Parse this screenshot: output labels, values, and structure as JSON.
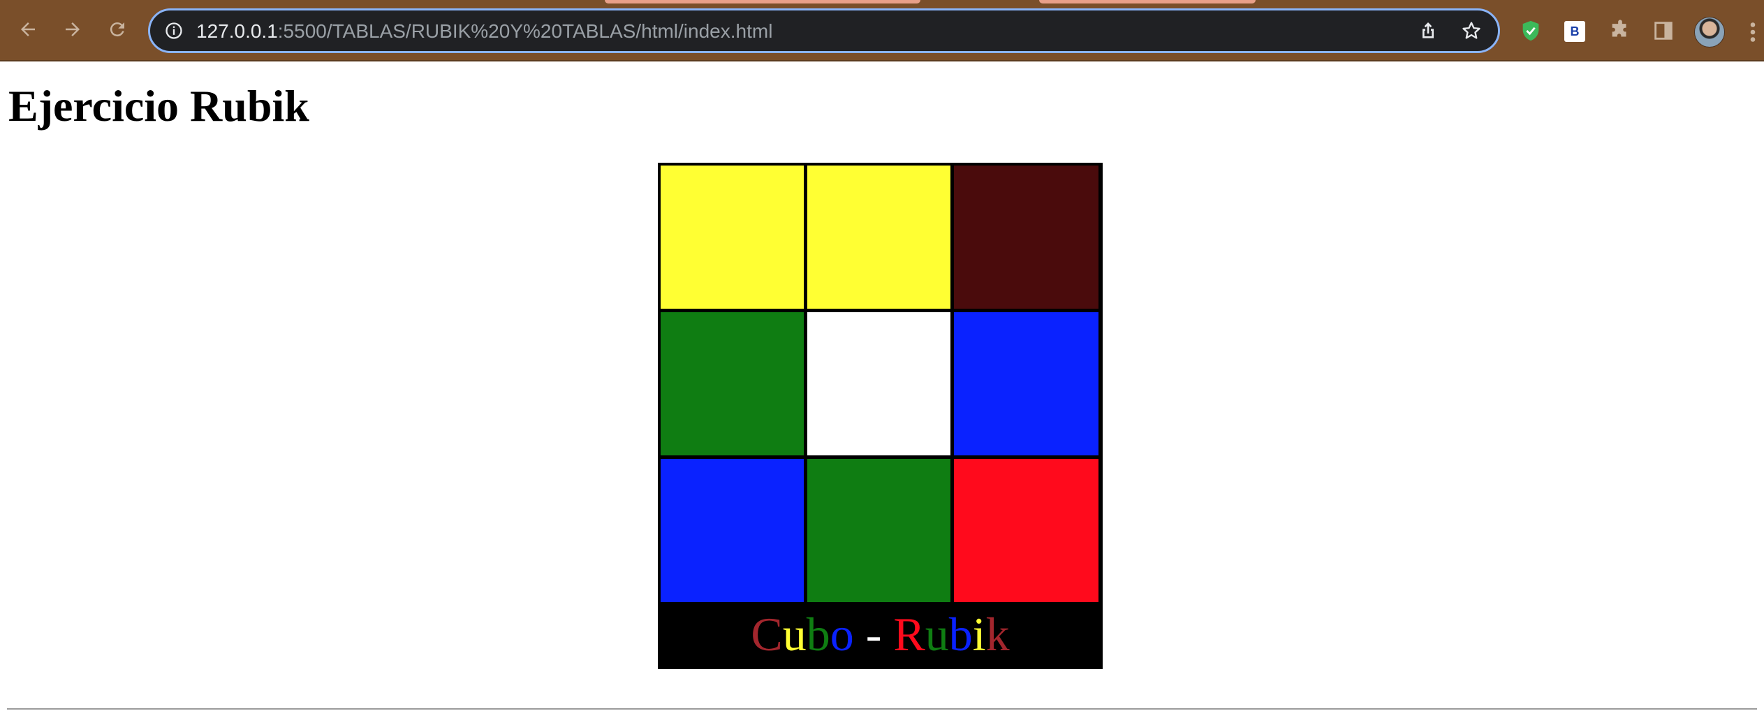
{
  "browser": {
    "url_host": "127.0.0.1",
    "url_path": ":5500/TABLAS/RUBIK%20Y%20TABLAS/html/index.html",
    "extension_b_label": "B",
    "nav_icons": [
      "back-arrow-icon",
      "forward-arrow-icon",
      "reload-icon"
    ],
    "toolbar_icons": [
      "site-info-icon",
      "share-icon",
      "bookmark-star-icon",
      "shield-check-icon",
      "extensions-puzzle-icon",
      "side-panel-icon",
      "kebab-menu-icon"
    ],
    "colors": {
      "frame": "#7a4f2a",
      "omnibox": "#202124",
      "omnibox_border": "#8ab4f8"
    }
  },
  "page": {
    "title": "Ejercicio Rubik",
    "rubik": {
      "rows": [
        [
          "#ffff33",
          "#ffff33",
          "#4a0b0c"
        ],
        [
          "#0f7d12",
          "#ffffff",
          "#0a22ff"
        ],
        [
          "#0a22ff",
          "#0f7d12",
          "#ff0a1c"
        ]
      ],
      "caption_letters": [
        {
          "char": "C",
          "color": "#a3262d"
        },
        {
          "char": "u",
          "color": "#ffff33"
        },
        {
          "char": "b",
          "color": "#0f7d12"
        },
        {
          "char": "o",
          "color": "#0a22ff"
        },
        {
          "char": " - ",
          "color": "#ffffff"
        },
        {
          "char": "R",
          "color": "#ff0a1c"
        },
        {
          "char": "u",
          "color": "#0f7d12"
        },
        {
          "char": "b",
          "color": "#0a22ff"
        },
        {
          "char": "i",
          "color": "#ffff33"
        },
        {
          "char": "k",
          "color": "#a3262d"
        }
      ]
    }
  }
}
